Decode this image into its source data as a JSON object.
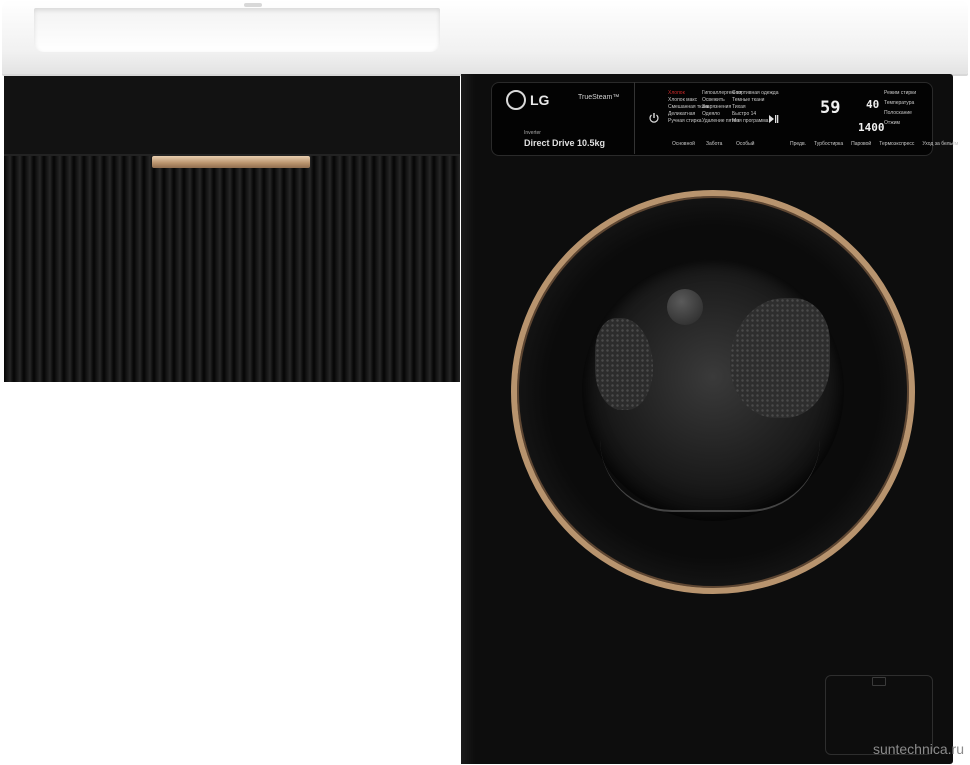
{
  "brand": {
    "logo_text": "LG",
    "feature": "TrueSteam™",
    "drive_top": "Inverter",
    "drive": "Direct Drive 10.5kg"
  },
  "panel": {
    "programs_col1": [
      "Хлопок",
      "Хлопок макс",
      "Смешанная ткань",
      "Деликатная",
      "Ручная стирка"
    ],
    "programs_col2": [
      "Гипоаллергенная",
      "Освежить",
      "Загрязнения",
      "Одеяло",
      "Удаление пятен"
    ],
    "programs_col3": [
      "Спортивная одежда",
      "Темные ткани",
      "Тихая",
      "Быстро 14",
      "Моя программа"
    ],
    "categories": [
      "Основной",
      "Забота",
      "Особый"
    ],
    "display_time": "59",
    "display_temp": "40",
    "display_spin": "1400",
    "options": [
      "Режим стирки",
      "Температура",
      "Полоскание",
      "Отжим"
    ],
    "bottom_buttons": [
      "Предв.",
      "Турбостирка",
      "Паровой",
      "Термоэкспресс",
      "Уход за бельём"
    ]
  },
  "colors": {
    "accent_gold": "#b8946e",
    "body": "#0d0d0d",
    "countertop": "#f2f2f2"
  },
  "watermark": "suntechnica.ru"
}
